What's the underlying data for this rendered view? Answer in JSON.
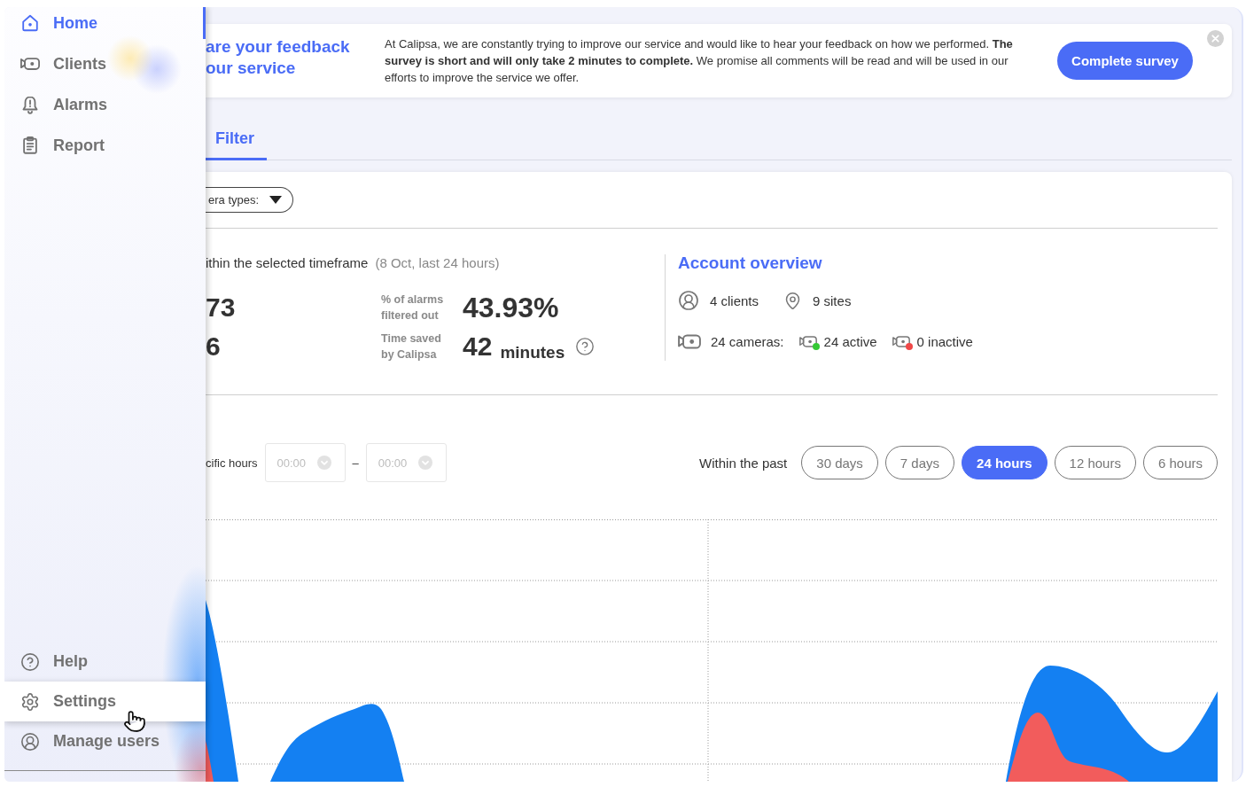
{
  "sidebar": {
    "nav_items": [
      {
        "label": "Home",
        "selected": true
      },
      {
        "label": "Clients",
        "selected": false
      },
      {
        "label": "Alarms",
        "selected": false
      },
      {
        "label": "Report",
        "selected": false
      }
    ],
    "footer_items": [
      {
        "label": "Help",
        "hovered": false
      },
      {
        "label": "Settings",
        "hovered": true
      },
      {
        "label": "Manage users",
        "hovered": false
      }
    ]
  },
  "feedback_banner": {
    "title_lines": [
      "are your feedback",
      "our service"
    ],
    "message": "At Calipsa, we are constantly trying to improve our service and would like to hear your feedback on how we performed. **The survey is short and will only take 2 minutes to complete.** We promise all comments will be read and will be used in our efforts to improve the service we offer.",
    "button": "Complete survey"
  },
  "tabs": [
    {
      "label": "Filter",
      "selected": true
    }
  ],
  "camera_type_filter": {
    "label": "era types:"
  },
  "summary": {
    "heading": "ithin the selected timeframe",
    "period": "(8 Oct, last 24 hours)",
    "rows": [
      {
        "count": "73",
        "metric_lines": [
          "% of alarms",
          "filtered out"
        ],
        "value": "43.93%"
      },
      {
        "count": "6",
        "metric_lines": [
          "Time saved",
          "by Calipsa"
        ],
        "value": "42",
        "unit": "minutes",
        "help": true
      }
    ]
  },
  "account_overview": {
    "title": "Account overview",
    "totals": [
      "4 clients",
      "9 sites"
    ],
    "cameras": [
      {
        "label": "24 cameras:",
        "kind": "total"
      },
      {
        "label": "24 active",
        "kind": "status",
        "color": "#35c935"
      },
      {
        "label": "0 inactive",
        "kind": "status",
        "color": "#f04848"
      }
    ]
  },
  "time_filter": {
    "hours_label": "cific hours",
    "from": {
      "placeholder": "00:00"
    },
    "separator": "–",
    "to": {
      "placeholder": "00:00"
    },
    "range_label": "Within the past",
    "ranges": [
      {
        "label": "30 days",
        "selected": false
      },
      {
        "label": "7 days",
        "selected": false
      },
      {
        "label": "24 hours",
        "selected": true
      },
      {
        "label": "12 hours",
        "selected": false
      },
      {
        "label": "6 hours",
        "selected": false
      }
    ]
  }
}
